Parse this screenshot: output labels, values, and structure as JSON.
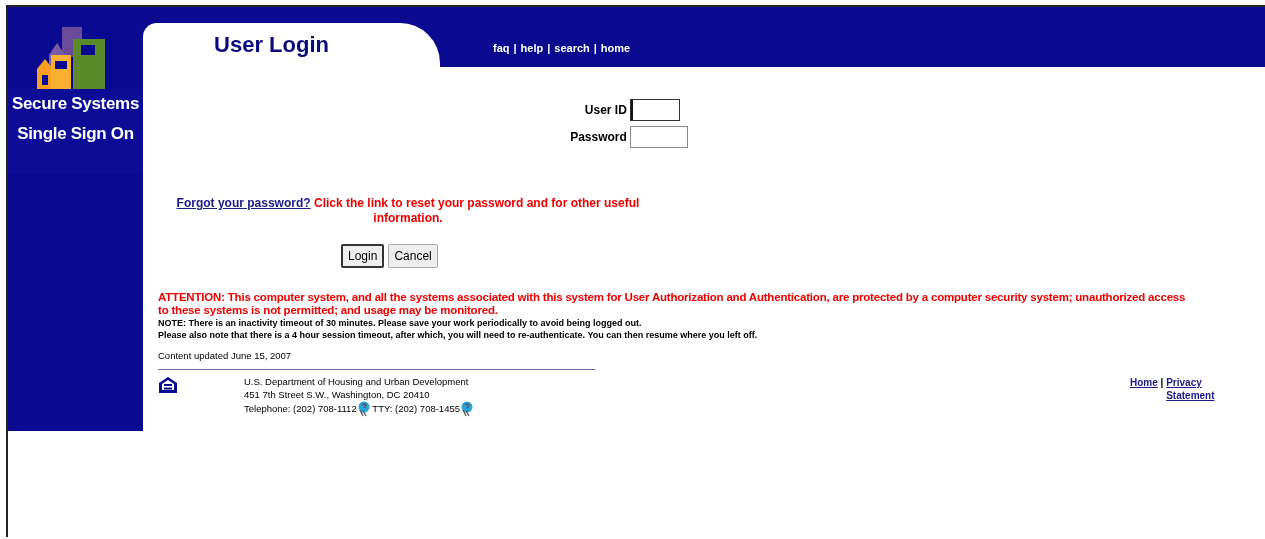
{
  "sidebar": {
    "title_lines": [
      "Secure Systems",
      "Single Sign On"
    ]
  },
  "header": {
    "title": "User Login",
    "nav": [
      "faq",
      "help",
      "search",
      "home"
    ],
    "separator": "|"
  },
  "form": {
    "fields": [
      {
        "label": "User ID",
        "focused": true
      },
      {
        "label": "Password",
        "focused": false
      }
    ],
    "forgot_link": "Forgot your password?",
    "forgot_note": "Click the link to reset your password and for other useful information.",
    "buttons": [
      {
        "label": "Login",
        "default": true
      },
      {
        "label": "Cancel",
        "default": false
      }
    ]
  },
  "notice": {
    "attention": "ATTENTION: This computer system, and all the systems associated with this system for User Authorization and Authentication, are protected by a computer security system; unauthorized access to these systems is not permitted; and usage may be monitored.",
    "notes": [
      "NOTE: There is an inactivity timeout of 30 minutes. Please save your work periodically to avoid being logged out.",
      "Please also note that there is a 4 hour session timeout, after which, you will need to re-authenticate. You can then resume where you left off."
    ],
    "updated": "Content updated June 15, 2007"
  },
  "footer": {
    "org": "U.S. Department of Housing and Urban Development",
    "address": "451 7th Street S.W., Washington, DC 20410",
    "phone": "Telephone: (202) 708-1112",
    "tty": "TTY: (202) 708-1455",
    "links": [
      "Home",
      "Privacy Statement"
    ],
    "separator": "|"
  }
}
